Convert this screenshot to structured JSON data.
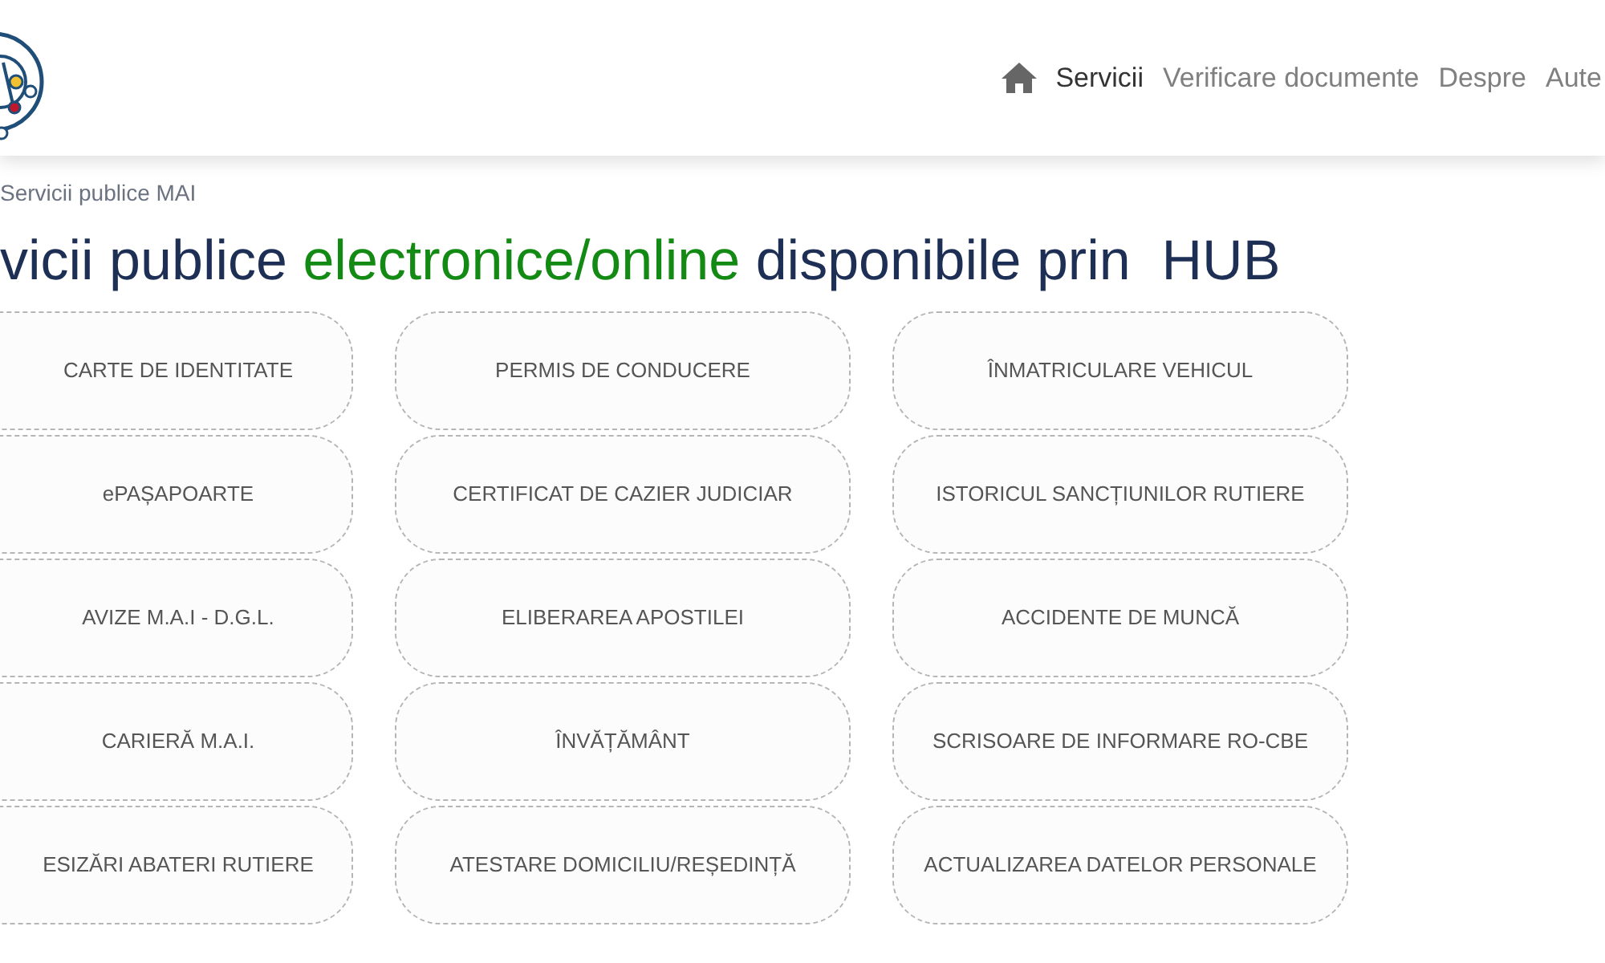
{
  "nav": {
    "items": [
      {
        "label": "Servicii",
        "selected": true
      },
      {
        "label": "Verificare documente",
        "selected": false
      },
      {
        "label": "Despre",
        "selected": false
      },
      {
        "label": "Aute",
        "selected": false
      }
    ]
  },
  "breadcrumb": "Servicii publice MAI",
  "heading": "vicii publice **electronice/online** disponibile prin  HUB",
  "services": [
    {
      "label": "CARTE DE IDENTITATE"
    },
    {
      "label": "PERMIS DE CONDUCERE"
    },
    {
      "label": "ÎNMATRICULARE VEHICUL"
    },
    {
      "label": "ePAȘAPOARTE"
    },
    {
      "label": "CERTIFICAT DE CAZIER JUDICIAR"
    },
    {
      "label": "ISTORICUL SANCȚIUNILOR RUTIERE"
    },
    {
      "label": "AVIZE M.A.I - D.G.L."
    },
    {
      "label": "ELIBERAREA APOSTILEI"
    },
    {
      "label": "ACCIDENTE DE MUNCĂ"
    },
    {
      "label": "CARIERĂ M.A.I."
    },
    {
      "label": "ÎNVĂȚĂMÂNT"
    },
    {
      "label": "SCRISOARE DE INFORMARE RO-CBE"
    },
    {
      "label": "ESIZĂRI ABATERI RUTIERE"
    },
    {
      "label": "ATESTARE DOMICILIU/REȘEDINȚĂ"
    },
    {
      "label": "ACTUALIZAREA DATELOR PERSONALE"
    }
  ]
}
